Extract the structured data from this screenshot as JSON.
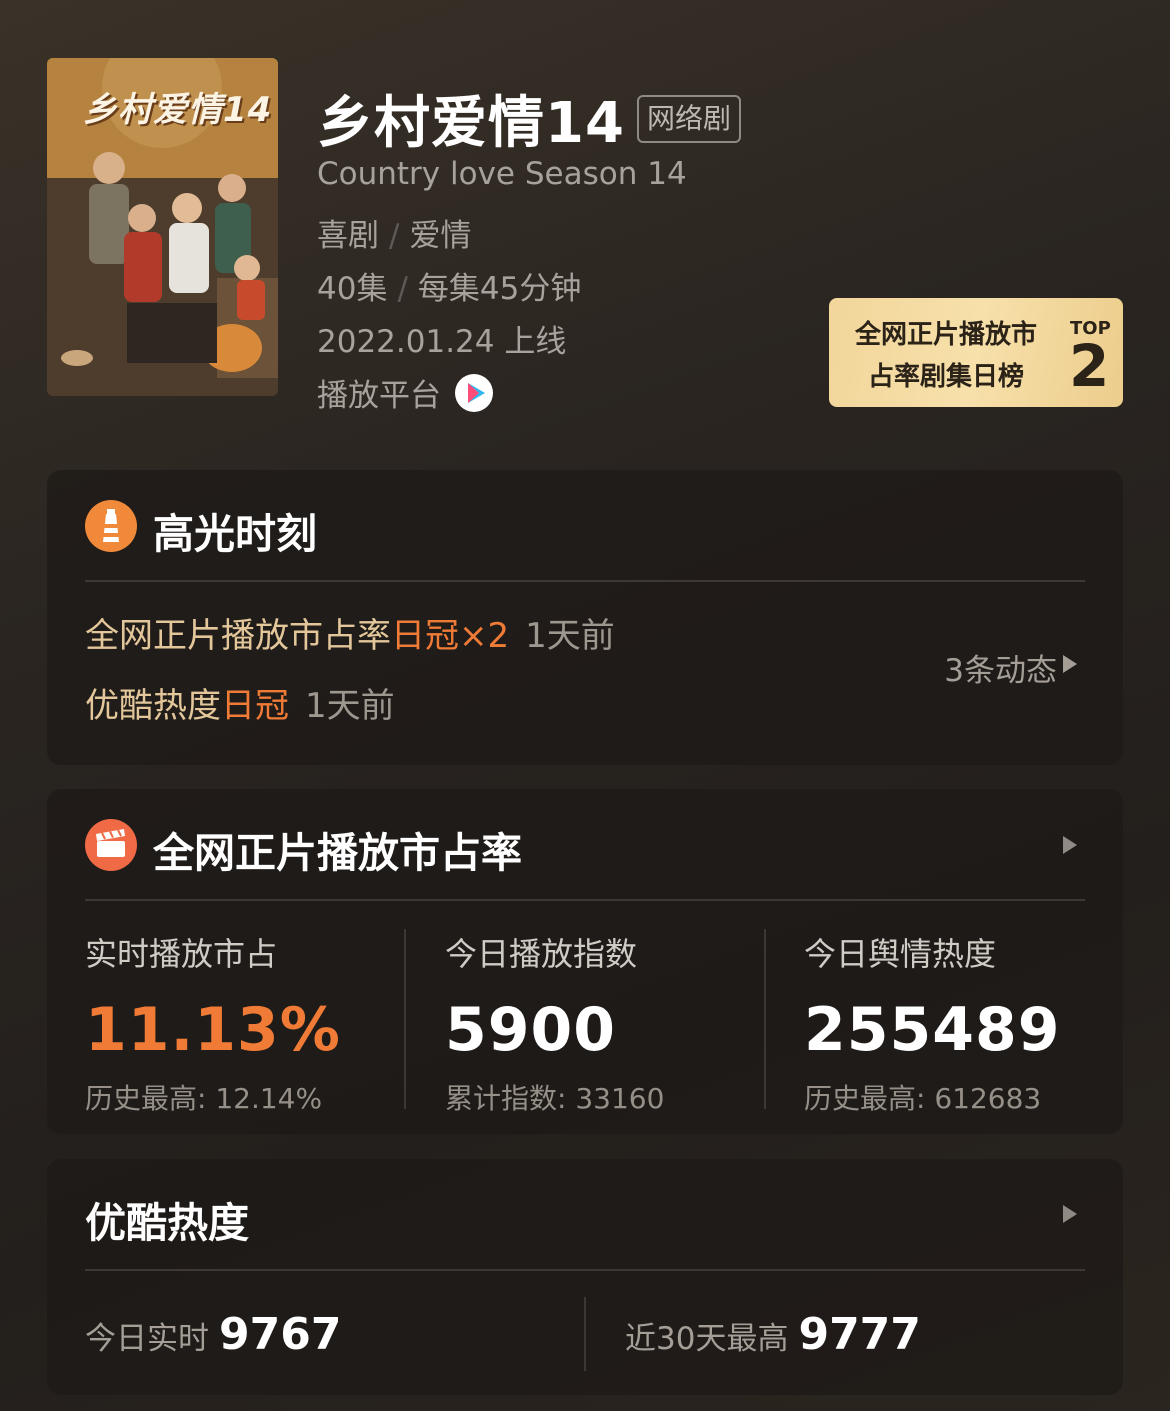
{
  "show": {
    "title": "乡村爱情14",
    "type_tag": "网络剧",
    "english_title": "Country love Season 14",
    "genres": [
      "喜剧",
      "爱情"
    ],
    "episodes": "40集",
    "duration": "每集45分钟",
    "release": "2022.01.24 上线",
    "platform_label": "播放平台",
    "poster_text": "乡村爱情14"
  },
  "rank_badge": {
    "line1": "全网正片播放市",
    "line2": "占率剧集日榜",
    "top_label": "TOP",
    "rank": "2"
  },
  "highlights": {
    "title": "高光时刻",
    "items": [
      {
        "text": "全网正片播放市占率",
        "accent": "日冠×2",
        "ago": "1天前"
      },
      {
        "text": "优酷热度",
        "accent": "日冠",
        "ago": "1天前"
      }
    ],
    "more": "3条动态"
  },
  "market_share": {
    "title": "全网正片播放市占率",
    "stats": [
      {
        "label": "实时播放市占",
        "value": "11.13%",
        "sub": "历史最高: 12.14%"
      },
      {
        "label": "今日播放指数",
        "value": "5900",
        "sub": "累计指数: 33160"
      },
      {
        "label": "今日舆情热度",
        "value": "255489",
        "sub": "历史最高: 612683"
      }
    ]
  },
  "heat": {
    "title": "优酷热度",
    "today_label": "今日实时",
    "today_value": "9767",
    "max_label": "近30天最高",
    "max_value": "9777"
  },
  "colors": {
    "accent_orange": "#f07b36",
    "gold": "#e3c79a",
    "badge_gold": "#f2d69b"
  },
  "icons": [
    "lighthouse-icon",
    "clapperboard-icon",
    "platform-logo-icon",
    "chevron-right-icon"
  ]
}
